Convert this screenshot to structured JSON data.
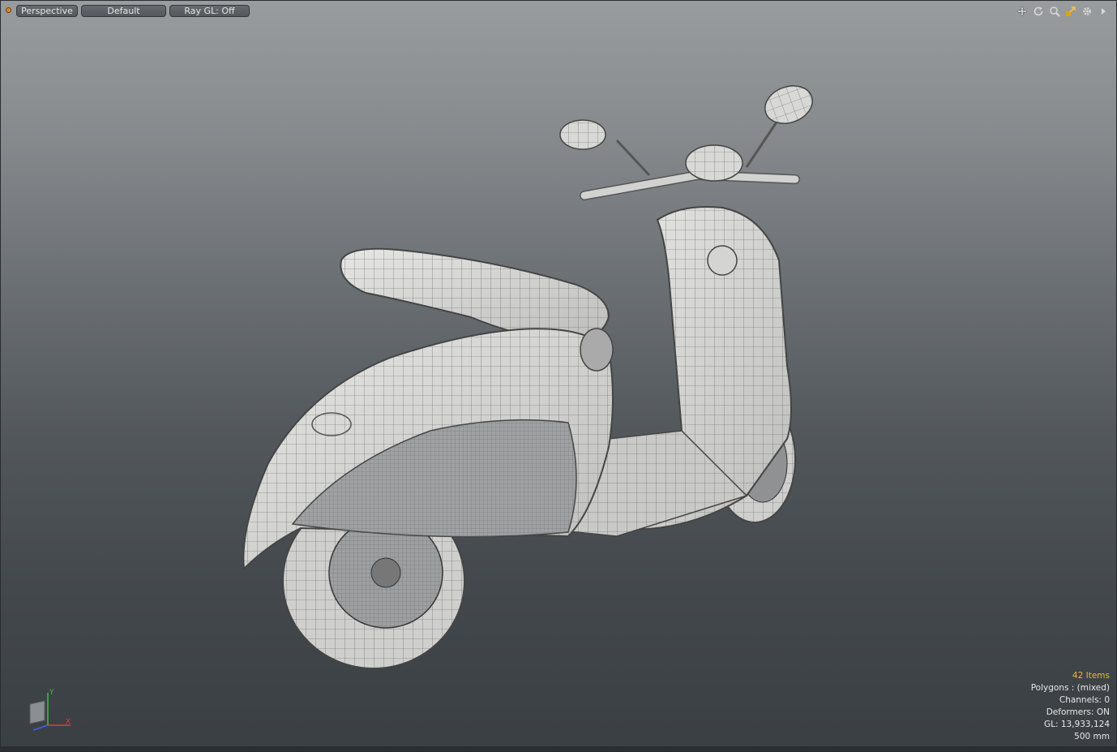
{
  "toolbar": {
    "view_mode": "Perspective",
    "shading": "Default",
    "ray_gl": "Ray GL: Off"
  },
  "nav_icons": [
    "move-view-icon",
    "rotate-view-icon",
    "zoom-view-icon",
    "fit-view-icon",
    "settings-icon",
    "expand-arrow-icon"
  ],
  "info": {
    "items": "42 Items",
    "polygons": "Polygons : (mixed)",
    "channels": "Channels: 0",
    "deformers": "Deformers: ON",
    "gl": "GL: 13,933,124",
    "scale": "500 mm"
  },
  "axis": {
    "y": "Y",
    "x": "X"
  },
  "colors": {
    "accent": "#f0b43c",
    "indicator": "#d58a2a"
  }
}
